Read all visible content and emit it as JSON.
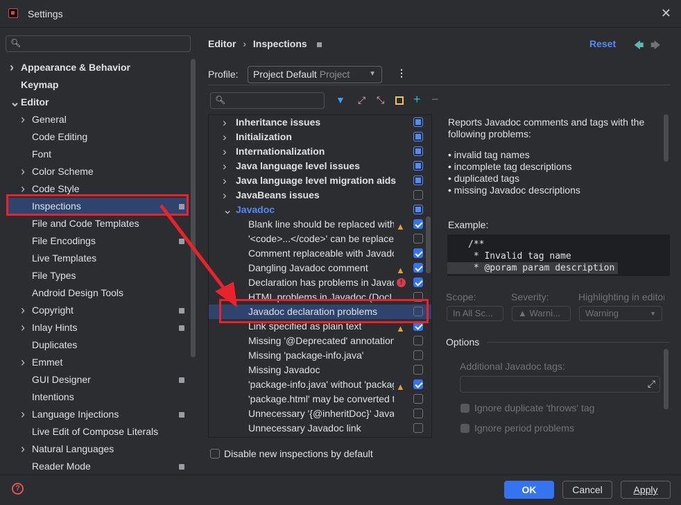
{
  "window": {
    "title": "Settings"
  },
  "sidebar": {
    "search_placeholder": "",
    "items": [
      {
        "label": "Appearance & Behavior",
        "bold": true,
        "chev": ">",
        "lvl": 0
      },
      {
        "label": "Keymap",
        "bold": true,
        "chev": "",
        "lvl": 0
      },
      {
        "label": "Editor",
        "bold": true,
        "chev": "v",
        "lvl": 0
      },
      {
        "label": "General",
        "chev": ">",
        "lvl": 1
      },
      {
        "label": "Code Editing",
        "lvl": 1
      },
      {
        "label": "Font",
        "lvl": 1
      },
      {
        "label": "Color Scheme",
        "chev": ">",
        "lvl": 1
      },
      {
        "label": "Code Style",
        "chev": ">",
        "lvl": 1
      },
      {
        "label": "Inspections",
        "lvl": 1,
        "badge": true,
        "selected": true
      },
      {
        "label": "File and Code Templates",
        "lvl": 1
      },
      {
        "label": "File Encodings",
        "lvl": 1,
        "badge": true
      },
      {
        "label": "Live Templates",
        "lvl": 1
      },
      {
        "label": "File Types",
        "lvl": 1
      },
      {
        "label": "Android Design Tools",
        "lvl": 1
      },
      {
        "label": "Copyright",
        "chev": ">",
        "lvl": 1,
        "badge": true
      },
      {
        "label": "Inlay Hints",
        "chev": ">",
        "lvl": 1,
        "badge": true
      },
      {
        "label": "Duplicates",
        "lvl": 1
      },
      {
        "label": "Emmet",
        "chev": ">",
        "lvl": 1
      },
      {
        "label": "GUI Designer",
        "lvl": 1,
        "badge": true
      },
      {
        "label": "Intentions",
        "lvl": 1
      },
      {
        "label": "Language Injections",
        "chev": ">",
        "lvl": 1,
        "badge": true
      },
      {
        "label": "Live Edit of Compose Literals",
        "lvl": 1
      },
      {
        "label": "Natural Languages",
        "chev": ">",
        "lvl": 1
      },
      {
        "label": "Reader Mode",
        "lvl": 1,
        "badge": true
      }
    ]
  },
  "header": {
    "breadcrumb": [
      "Editor",
      "Inspections"
    ],
    "reset": "Reset"
  },
  "profile": {
    "label": "Profile:",
    "value": "Project Default",
    "scope": "Project"
  },
  "tree": {
    "rows": [
      {
        "label": "Inheritance issues",
        "group": true,
        "state": "partial"
      },
      {
        "label": "Initialization",
        "group": true,
        "state": "partial"
      },
      {
        "label": "Internationalization",
        "group": true,
        "state": "partial"
      },
      {
        "label": "Java language level issues",
        "group": true,
        "state": "partial"
      },
      {
        "label": "Java language level migration aids",
        "group": true,
        "state": "partial"
      },
      {
        "label": "JavaBeans issues",
        "group": true,
        "state": "off"
      },
      {
        "label": "Javadoc",
        "group": true,
        "expanded": true,
        "state": "partial"
      },
      {
        "label": "Blank line should be replaced with <p>",
        "state": "on",
        "sev": "warning"
      },
      {
        "label": "'<code>...</code>' can be replaced with '{@code ...}'",
        "state": "off"
      },
      {
        "label": "Comment replaceable with Javadoc",
        "state": "on"
      },
      {
        "label": "Dangling Javadoc comment",
        "state": "on",
        "sev": "warning"
      },
      {
        "label": "Declaration has problems in Javadoc references",
        "state": "on",
        "sev": "error"
      },
      {
        "label": "HTML problems in Javadoc (DocLint)",
        "state": "off"
      },
      {
        "label": "Javadoc declaration problems",
        "state": "off",
        "selected": true
      },
      {
        "label": "Link specified as plain text",
        "state": "on",
        "sev": "warning"
      },
      {
        "label": "Missing '@Deprecated' annotation",
        "state": "off"
      },
      {
        "label": "Missing 'package-info.java'",
        "state": "off"
      },
      {
        "label": "Missing Javadoc",
        "state": "off"
      },
      {
        "label": "'package-info.java' without 'package' statement",
        "state": "on",
        "sev": "warning"
      },
      {
        "label": "'package.html' may be converted to 'package-info.java'",
        "state": "off"
      },
      {
        "label": "Unnecessary '{@inheritDoc}' Javadoc comment",
        "state": "off"
      },
      {
        "label": "Unnecessary Javadoc link",
        "state": "off"
      }
    ]
  },
  "description": {
    "intro": "Reports Javadoc comments and tags with the following problems:",
    "bullets": [
      "• invalid tag names",
      "• incomplete tag descriptions",
      "• duplicated tags",
      "• missing Javadoc descriptions"
    ],
    "example_label": "Example:",
    "code": [
      "/**",
      " * Invalid tag name",
      " * @poram param description"
    ]
  },
  "settings": {
    "scope_label": "Scope:",
    "scope_value": "In All Sc...",
    "severity_label": "Severity:",
    "severity_value": "Warni...",
    "highlight_label": "Highlighting in editor",
    "highlight_value": "Warning",
    "options_label": "Options",
    "tags_label": "Additional Javadoc tags:",
    "opt1": "Ignore duplicate 'throws' tag",
    "opt2": "Ignore period problems"
  },
  "disable_new": "Disable new inspections by default",
  "footer": {
    "ok": "OK",
    "cancel": "Cancel",
    "apply": "Apply"
  },
  "colors": {
    "accent": "#3574f0",
    "link": "#548af7",
    "annotation": "#e8232b",
    "selection": "#2e436e"
  }
}
